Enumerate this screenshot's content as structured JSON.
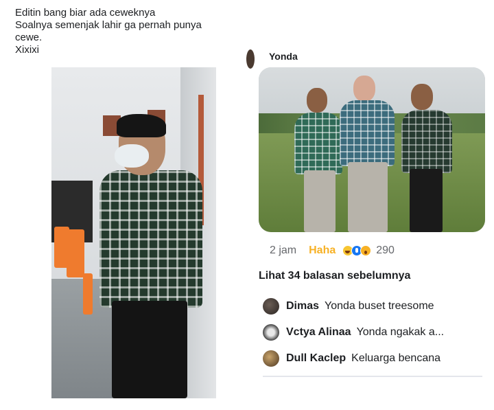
{
  "left_post": {
    "lines": [
      "Editin bang biar ada ceweknya",
      "Soalnya semenjak lahir ga pernah punya",
      "cewe.",
      "Xixixi"
    ]
  },
  "right_post": {
    "author": "Yonda",
    "meta": {
      "time": "2 jam",
      "reaction_label": "Haha",
      "reaction_icons": [
        "laugh-emoji-icon",
        "like-icon",
        "wow-emoji-icon"
      ],
      "reaction_count": "290"
    },
    "see_previous": "Lihat 34 balasan sebelumnya",
    "replies": [
      {
        "name": "Dimas",
        "text": "Yonda buset treesome"
      },
      {
        "name": "Vctya Alinaa",
        "text": "Yonda ngakak a..."
      },
      {
        "name": "Dull Kaclep",
        "text": "Keluarga bencana"
      }
    ]
  },
  "colors": {
    "haha": "#f7b125",
    "text": "#1c1e21",
    "muted": "#65676b"
  }
}
